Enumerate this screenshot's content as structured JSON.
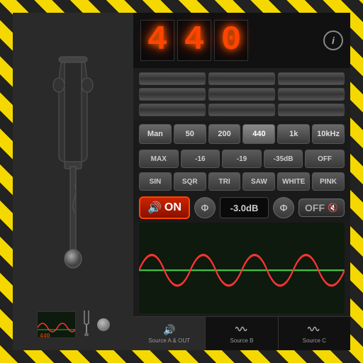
{
  "app": {
    "title": "Tuning Fork 440",
    "hazard_border": true
  },
  "display": {
    "frequency": "440",
    "digit1": "4",
    "digit2": "4",
    "digit3": "0",
    "info_label": "i"
  },
  "freq_buttons": [
    {
      "label": "Man",
      "active": false
    },
    {
      "label": "50",
      "active": false
    },
    {
      "label": "200",
      "active": false
    },
    {
      "label": "440",
      "active": true
    },
    {
      "label": "1k",
      "active": false
    },
    {
      "label": "10kHz",
      "active": false
    }
  ],
  "level_buttons": [
    {
      "label": "MAX"
    },
    {
      "label": "-16"
    },
    {
      "label": "-19"
    },
    {
      "label": "-35dB"
    },
    {
      "label": "OFF"
    }
  ],
  "wave_buttons": [
    {
      "label": "SIN"
    },
    {
      "label": "SQR"
    },
    {
      "label": "TRI"
    },
    {
      "label": "SAW"
    },
    {
      "label": "WHITE"
    },
    {
      "label": "PINK"
    }
  ],
  "control": {
    "on_label": "ON",
    "phase_symbol": "Φ",
    "db_value": "-3.0dB",
    "off_label": "OFF"
  },
  "bottom_tabs": [
    {
      "label": "Source A & OUT",
      "active": true
    },
    {
      "label": "Source B",
      "active": false
    },
    {
      "label": "Source C",
      "active": false
    }
  ]
}
